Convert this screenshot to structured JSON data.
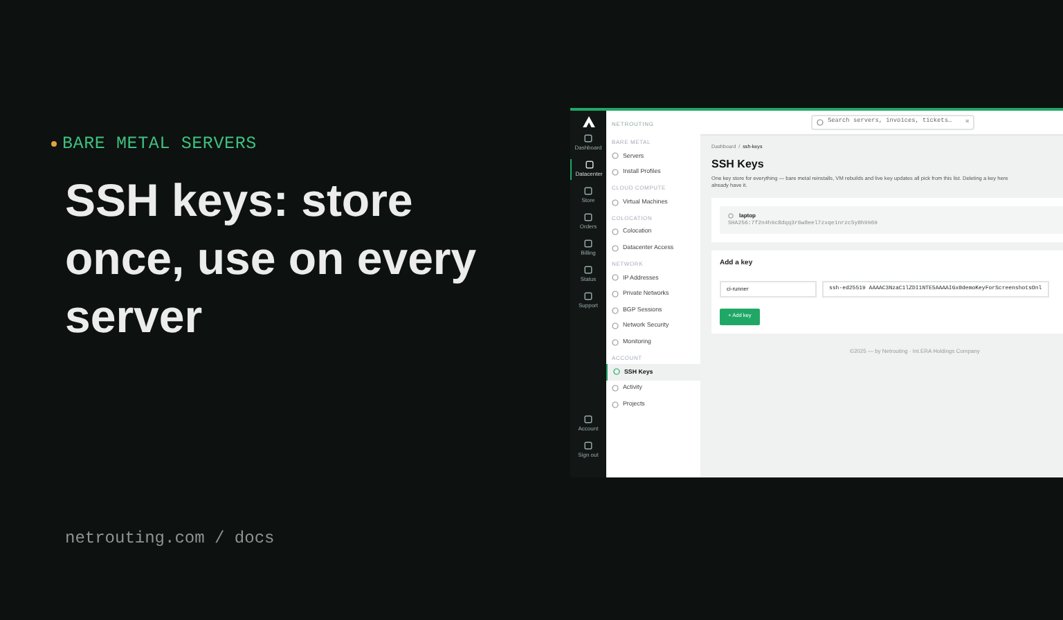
{
  "hero": {
    "eyebrow": "BARE METAL SERVERS",
    "title": "SSH keys: store once, use on every server",
    "footer": "netrouting.com / docs"
  },
  "app": {
    "brand": "NETROUTING",
    "search": {
      "placeholder": "Search servers, invoices, tickets…",
      "shortcut": "⌘"
    },
    "rail": [
      {
        "label": "Dashboard",
        "selected": false
      },
      {
        "label": "Datacenter",
        "selected": true
      },
      {
        "label": "Store",
        "selected": false
      },
      {
        "label": "Orders",
        "selected": false
      },
      {
        "label": "Billing",
        "selected": false
      },
      {
        "label": "Status",
        "selected": false
      },
      {
        "label": "Support",
        "selected": false
      }
    ],
    "rail_bottom": [
      {
        "label": "Account"
      },
      {
        "label": "Sign out"
      }
    ],
    "sidebar": [
      {
        "heading": "BARE METAL",
        "items": [
          {
            "label": "Servers",
            "selected": false
          },
          {
            "label": "Install Profiles",
            "selected": false
          }
        ]
      },
      {
        "heading": "CLOUD COMPUTE",
        "items": [
          {
            "label": "Virtual Machines",
            "selected": false
          }
        ]
      },
      {
        "heading": "COLOCATION",
        "items": [
          {
            "label": "Colocation",
            "selected": false
          },
          {
            "label": "Datacenter Access",
            "selected": false
          }
        ]
      },
      {
        "heading": "NETWORK",
        "items": [
          {
            "label": "IP Addresses",
            "selected": false
          },
          {
            "label": "Private Networks",
            "selected": false
          },
          {
            "label": "BGP Sessions",
            "selected": false
          },
          {
            "label": "Network Security",
            "selected": false
          },
          {
            "label": "Monitoring",
            "selected": false
          }
        ]
      },
      {
        "heading": "ACCOUNT",
        "items": [
          {
            "label": "SSH Keys",
            "selected": true
          },
          {
            "label": "Activity",
            "selected": false
          },
          {
            "label": "Projects",
            "selected": false
          }
        ]
      }
    ],
    "breadcrumb": [
      "Dashboard",
      "ssh-keys"
    ],
    "breadcrumb_separator": "/",
    "title": "SSH Keys",
    "description": "One key store for everything — bare metal reinstalls, VM rebuilds and live key updates all pick from this list. Deleting a key here",
    "description_2": "already have it.",
    "keys": [
      {
        "name": "laptop",
        "fingerprint": "SHA256:7f2n4h9c8dqq3r6w8eel7zxqe1nrzc5y0h9969"
      }
    ],
    "add_key": {
      "title": "Add a key",
      "name_value": "ci-runner",
      "key_value": "ssh-ed25519 AAAAC3NzaC1lZDI1NTE5AAAAIGx0demoKeyForScreenshotsOnl",
      "button": "+ Add key"
    },
    "footer": "©2025 — by Netrouting · Int.ERA Holdings Company"
  }
}
